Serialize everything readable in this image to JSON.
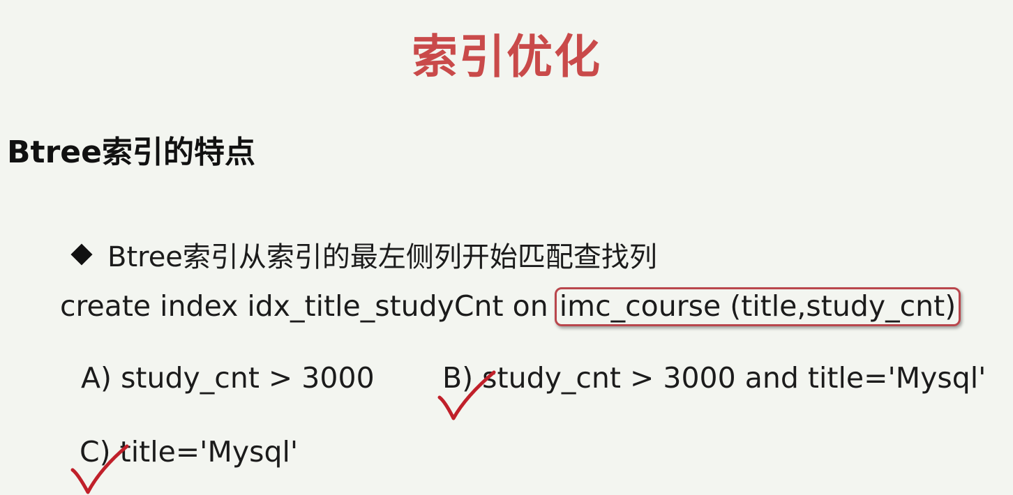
{
  "slide": {
    "title": "索引优化",
    "subtitle": "Btree索引的特点",
    "bullet": {
      "icon": "diamond-bullet-icon",
      "text": "Btree索引从索引的最左侧列开始匹配查找列"
    },
    "code": {
      "prefix": "create index idx_title_studyCnt on ",
      "highlighted": "imc_course (title,study_cnt)"
    },
    "options": [
      {
        "text": "A) study_cnt > 3000",
        "checked": false
      },
      {
        "text": "B) study_cnt > 3000 and title='Mysql'",
        "checked": true
      },
      {
        "text": "C) title='Mysql'",
        "checked": true
      }
    ],
    "colors": {
      "title": "#c94a4a",
      "highlight_border": "#b9464c",
      "checkmark": "#c0202a",
      "background": "#f3f5f0"
    }
  }
}
